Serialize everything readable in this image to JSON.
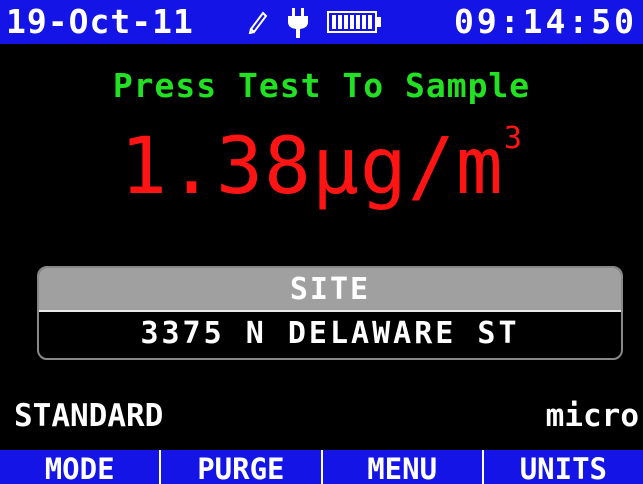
{
  "status_bar": {
    "date": "19-Oct-11",
    "time": "09:14:50",
    "icons": [
      "pen-icon",
      "power-plug-icon",
      "battery-icon"
    ]
  },
  "main": {
    "prompt": "Press Test To Sample",
    "reading_value": "1.38",
    "reading_unit": "µg/m",
    "reading_superscript": "3"
  },
  "site": {
    "header": "SITE",
    "value": "3375 N DELAWARE ST"
  },
  "footer_info": {
    "mode": "STANDARD",
    "units": "micro"
  },
  "softkeys": [
    "MODE",
    "PURGE",
    "MENU",
    "UNITS"
  ],
  "colors": {
    "bar": "#1414e6",
    "prompt": "#22e022",
    "reading": "#ff1414",
    "site_header": "#a0a0a0"
  }
}
